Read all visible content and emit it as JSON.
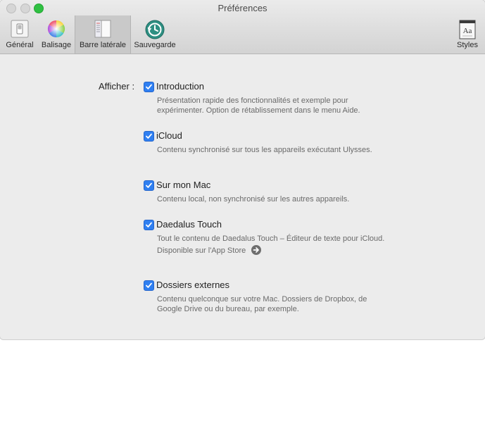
{
  "window": {
    "title": "Préférences"
  },
  "toolbar": {
    "items": [
      {
        "label": "Général",
        "icon": "switch-icon"
      },
      {
        "label": "Balisage",
        "icon": "color-wheel-icon"
      },
      {
        "label": "Barre latérale",
        "icon": "sidebar-icon",
        "selected": true
      },
      {
        "label": "Sauvegarde",
        "icon": "time-machine-icon"
      },
      {
        "label": "Styles",
        "icon": "styles-icon"
      }
    ]
  },
  "sidebar_prefs": {
    "show_label": "Afficher :",
    "options": [
      {
        "label": "Introduction",
        "checked": true,
        "desc": "Présentation rapide des fonctionnalités et exemple pour expérimenter. Option de rétablissement dans le menu Aide."
      },
      {
        "label": "iCloud",
        "checked": true,
        "desc": "Contenu synchronisé sur tous les appareils exécutant Ulysses."
      },
      {
        "label": "Sur mon Mac",
        "checked": true,
        "desc": "Contenu local, non synchronisé sur les autres appareils."
      },
      {
        "label": "Daedalus Touch",
        "checked": true,
        "desc": "Tout le contenu de Daedalus Touch – Éditeur de texte pour iCloud.",
        "link": "Disponible sur l'App Store"
      },
      {
        "label": "Dossiers externes",
        "checked": true,
        "desc": "Contenu quelconque sur votre Mac. Dossiers de Dropbox, de Google Drive ou du bureau, par exemple."
      }
    ]
  },
  "colors": {
    "checkbox": "#2f7ff1",
    "traffic_max": "#2fc042"
  },
  "icon_styles_glyph": "Aa"
}
